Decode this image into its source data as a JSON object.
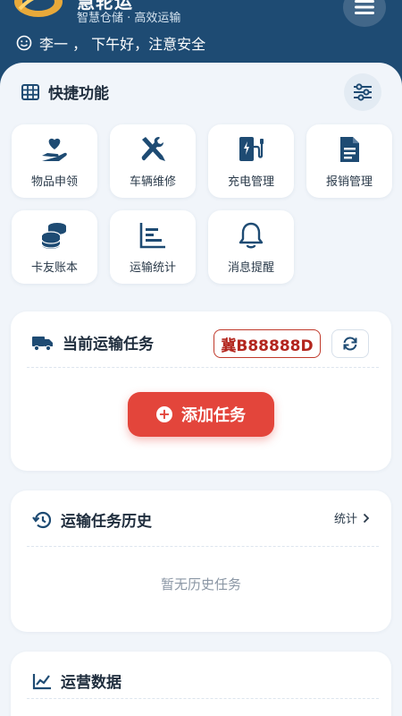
{
  "header": {
    "app_name": "慧轮运",
    "tagline": "智慧仓储 · 高效运输",
    "greeting": "李一 ， 下午好，注意安全"
  },
  "quick": {
    "title": "快捷功能",
    "items": [
      {
        "label": "物品申领",
        "icon": "hand-heart-icon"
      },
      {
        "label": "车辆维修",
        "icon": "tools-icon"
      },
      {
        "label": "充电管理",
        "icon": "charging-station-icon"
      },
      {
        "label": "报销管理",
        "icon": "document-icon"
      },
      {
        "label": "卡友账本",
        "icon": "coins-icon"
      },
      {
        "label": "运输统计",
        "icon": "bar-chart-icon"
      },
      {
        "label": "消息提醒",
        "icon": "bell-icon"
      }
    ]
  },
  "current_task": {
    "title": "当前运输任务",
    "plate": "冀B88888D",
    "add_label": "添加任务"
  },
  "history": {
    "title": "运输任务历史",
    "stats_label": "统计",
    "empty": "暂无历史任务"
  },
  "operations": {
    "title": "运营数据"
  },
  "colors": {
    "header_bg": "#1e4b73",
    "icon": "#1e4b73",
    "accent_red": "#e3453b",
    "plate_red": "#b3261e"
  }
}
